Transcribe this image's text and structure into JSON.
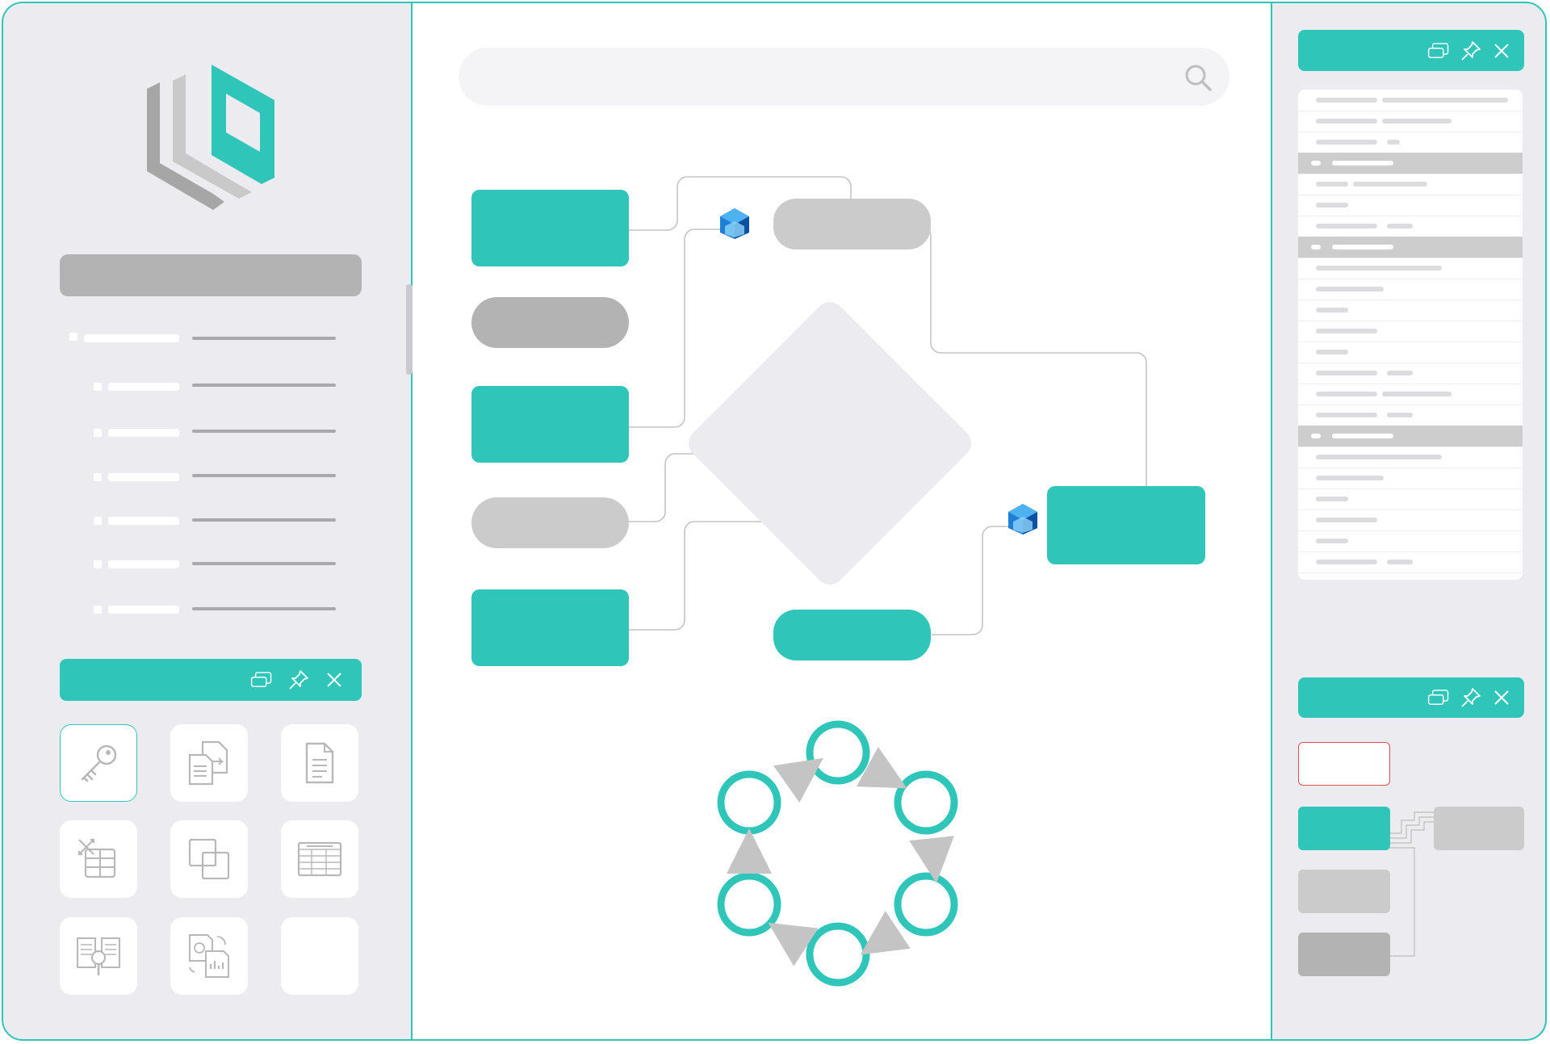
{
  "colors": {
    "accent": "#2fc6b9",
    "panel_bg": "#ebebf0",
    "gray_dark": "#b3b3b3",
    "gray_light": "#cbcbcb",
    "selected_outline": "#e0504d",
    "badge_blue": "#1e7fd6"
  },
  "app": {
    "logo_icon": "layered-cube-logo-icon"
  },
  "search": {
    "placeholder": "",
    "icon": "search-icon"
  },
  "left_panel": {
    "title_bar": "",
    "tree_items": [
      "",
      "",
      "",
      "",
      "",
      "",
      ""
    ],
    "toolbox": {
      "header_icons": [
        "restore-window-icon",
        "pin-icon",
        "close-icon"
      ],
      "tools": [
        {
          "icon": "key-icon",
          "selected": true
        },
        {
          "icon": "document-transfer-icon",
          "selected": false
        },
        {
          "icon": "document-icon",
          "selected": false
        },
        {
          "icon": "table-shuffle-icon",
          "selected": false
        },
        {
          "icon": "overlap-squares-icon",
          "selected": false
        },
        {
          "icon": "spreadsheet-icon",
          "selected": false
        },
        {
          "icon": "document-search-icon",
          "selected": false
        },
        {
          "icon": "report-refresh-icon",
          "selected": false
        },
        {
          "icon": "empty-tool-slot",
          "selected": false
        }
      ]
    }
  },
  "right_panel": {
    "properties": {
      "header_icons": [
        "restore-window-icon",
        "pin-icon",
        "close-icon"
      ],
      "rows": [
        {
          "group": false
        },
        {
          "group": false
        },
        {
          "group": false
        },
        {
          "group": true
        },
        {
          "group": false
        },
        {
          "group": false
        },
        {
          "group": false
        },
        {
          "group": true
        },
        {
          "group": false
        },
        {
          "group": false
        },
        {
          "group": false
        },
        {
          "group": false
        },
        {
          "group": false
        },
        {
          "group": false
        },
        {
          "group": false
        },
        {
          "group": false
        },
        {
          "group": true
        },
        {
          "group": false
        },
        {
          "group": false
        },
        {
          "group": false
        },
        {
          "group": false
        },
        {
          "group": false
        },
        {
          "group": false
        }
      ]
    },
    "mini_map": {
      "header_icons": [
        "restore-window-icon",
        "pin-icon",
        "close-icon"
      ]
    }
  },
  "diagram": {
    "badge_icon": "cube-badge-icon",
    "cycle_arrow_icon": "arrow-icon"
  }
}
